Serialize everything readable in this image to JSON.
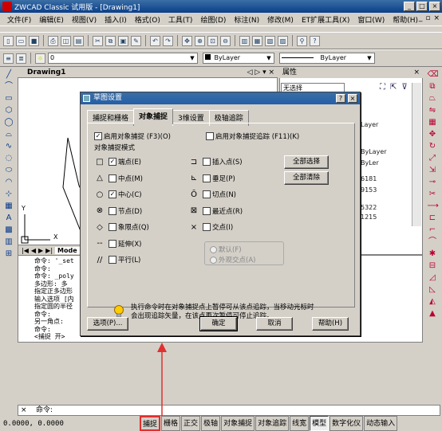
{
  "window": {
    "title": "ZWCAD Classic 试用版 - [Drawing1]"
  },
  "menus": [
    "文件(F)",
    "编辑(E)",
    "视图(V)",
    "插入(I)",
    "格式(O)",
    "工具(T)",
    "绘图(D)",
    "标注(N)",
    "修改(M)",
    "ET扩展工具(X)",
    "窗口(W)",
    "帮助(H)"
  ],
  "toolbar2": {
    "layer_value": "0",
    "color_value": "ByLayer",
    "linetype_value": "ByLayer"
  },
  "drawing": {
    "tab_label": "Drawing1",
    "model_tab": "Mode",
    "axis_x": "X",
    "axis_y": "Y"
  },
  "properties": {
    "header": "属性",
    "selection": "无选择",
    "values": [
      "Layer",
      "ByLayer",
      "ByLer",
      "6181",
      "9153",
      "5322",
      "1215"
    ]
  },
  "command_history": [
    "命令: '_set",
    "命令:",
    "命令: _poly",
    "多边形:  多",
    "指定正多边形",
    "输入选项 [内",
    "指定圆的半径",
    "命令:",
    "另一角点:",
    "命令:",
    "<捕捉 开>"
  ],
  "command_line": {
    "prompt": "命令:"
  },
  "status": {
    "coords": "0.0000, 0.0000",
    "buttons": [
      "捕捉",
      "栅格",
      "正交",
      "极轴",
      "对象捕捉",
      "对象追踪",
      "线宽",
      "模型",
      "数字化仪",
      "动态输入"
    ],
    "highlighted": "捕捉"
  },
  "dialog": {
    "title": "草图设置",
    "tabs": [
      "捕捉和栅格",
      "对象捕捉",
      "3维设置",
      "极轴追踪"
    ],
    "active_tab": "对象捕捉",
    "enable_osnap": "启用对象捕捉 (F3)(O)",
    "enable_track": "启用对象捕捉追踪 (F11)(K)",
    "group_label": "对象捕捉模式",
    "modes_left": [
      {
        "sym": "□",
        "label": "端点(E)",
        "checked": true
      },
      {
        "sym": "△",
        "label": "中点(M)",
        "checked": false
      },
      {
        "sym": "○",
        "label": "中心(C)",
        "checked": true
      },
      {
        "sym": "⊗",
        "label": "节点(D)",
        "checked": false
      },
      {
        "sym": "◇",
        "label": "象限点(Q)",
        "checked": false
      },
      {
        "sym": "--",
        "label": "延伸(X)",
        "checked": false
      },
      {
        "sym": "//",
        "label": "平行(L)",
        "checked": false
      }
    ],
    "modes_right": [
      {
        "sym": "⊐",
        "label": "插入点(S)",
        "checked": false
      },
      {
        "sym": "⊾",
        "label": "垂足(P)",
        "checked": false
      },
      {
        "sym": "Ō",
        "label": "切点(N)",
        "checked": false
      },
      {
        "sym": "⊠",
        "label": "最近点(R)",
        "checked": false
      },
      {
        "sym": "×",
        "label": "交点(I)",
        "checked": false
      }
    ],
    "radio_default": "默认(F)",
    "radio_apparent": "外观交点(A)",
    "select_all": "全部选择",
    "clear_all": "全部清除",
    "note": "执行命令时在对象捕捉点上暂停可从该点追踪，当移动光标时会出现追踪矢量，在该点再次暂停可停止追踪。",
    "options_btn": "选项(P)...",
    "ok_btn": "确定",
    "cancel_btn": "取消",
    "help_btn": "帮助(H)"
  }
}
